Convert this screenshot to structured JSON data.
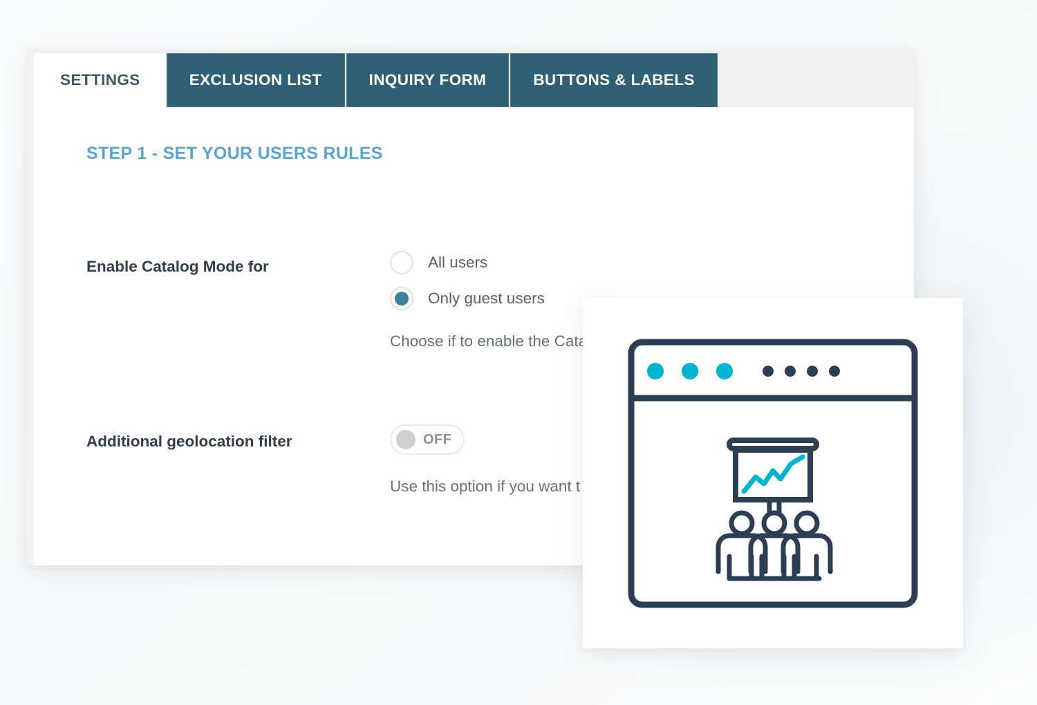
{
  "panel": {
    "tabs": [
      {
        "label": "SETTINGS",
        "active": true,
        "name": "tab-settings"
      },
      {
        "label": "EXCLUSION LIST",
        "active": false,
        "name": "tab-exclusion-list"
      },
      {
        "label": "INQUIRY FORM",
        "active": false,
        "name": "tab-inquiry-form"
      },
      {
        "label": "BUTTONS & LABELS",
        "active": false,
        "name": "tab-buttons-labels"
      }
    ],
    "step_title": "STEP 1 - SET YOUR USERS RULES",
    "fields": {
      "catalog_mode": {
        "label": "Enable Catalog Mode for",
        "options": [
          {
            "label": "All users",
            "selected": false
          },
          {
            "label": "Only guest users",
            "selected": true
          }
        ],
        "helper": "Choose if to enable the Cata"
      },
      "geolocation": {
        "label": "Additional geolocation filter",
        "toggle_state": "OFF",
        "helper": "Use this option if you want t"
      }
    }
  },
  "illustration": {
    "name": "browser-presentation-audience-illustration",
    "dots": {
      "accent_count": 3,
      "dark_count": 4,
      "accent_color": "#00b4d1",
      "dark_color": "#2c3e54"
    },
    "chart_line_color": "#00b4d1",
    "outline_color": "#2c3e54",
    "people_count": 3
  },
  "colors": {
    "tab_active_bg": "#ffffff",
    "tab_inactive_bg": "#2e6175",
    "tab_active_text": "#3e5768",
    "tab_inactive_text": "#ffffff",
    "step_title": "#5ba3d0",
    "field_label": "#2f3f4f",
    "body_text": "#59616b",
    "radio_selected": "#3c82a0",
    "toggle_knob": "#cfcfcf",
    "panel_chrome": "#f1f1f1",
    "page_bg": "#f7f9fa"
  }
}
